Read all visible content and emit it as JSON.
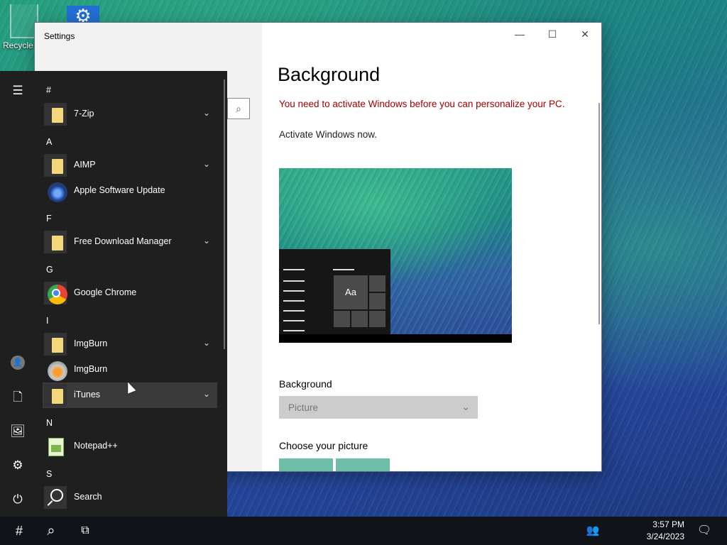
{
  "desktop": {
    "recycle_label": "Recycle",
    "recycle_icon": "recycle-bin-icon",
    "settings_icon": "gear-icon"
  },
  "settings_window": {
    "title": "Settings",
    "minimize_glyph": "—",
    "maximize_glyph": "☐",
    "close_glyph": "✕",
    "search_glyph": "⌕",
    "page_title": "Background",
    "warning": "You need to activate Windows before you can personalize your PC.",
    "activate_link": "Activate Windows now.",
    "preview_tile_text": "Aa",
    "background_label": "Background",
    "background_value": "Picture",
    "choose_picture_label": "Choose your picture",
    "warning_color": "#a80000"
  },
  "start_menu": {
    "rail": {
      "hamburger": "☰",
      "avatar_glyph": "👤",
      "documents": "🗋",
      "pictures": "🖼",
      "settings": "⚙",
      "power": "⏻"
    },
    "groups": [
      {
        "letter": "#"
      },
      {
        "letter": "A"
      },
      {
        "letter": "F"
      },
      {
        "letter": "G"
      },
      {
        "letter": "I"
      },
      {
        "letter": "N"
      },
      {
        "letter": "S"
      }
    ],
    "apps": [
      {
        "name": "7-Zip",
        "type": "folder",
        "expandable": true
      },
      {
        "name": "AIMP",
        "type": "folder",
        "expandable": true
      },
      {
        "name": "Apple Software Update",
        "type": "app",
        "expandable": false
      },
      {
        "name": "Free Download Manager",
        "type": "folder",
        "expandable": true
      },
      {
        "name": "Google Chrome",
        "type": "app",
        "expandable": false
      },
      {
        "name": "ImgBurn",
        "type": "folder",
        "expandable": true
      },
      {
        "name": "ImgBurn",
        "type": "app",
        "expandable": false
      },
      {
        "name": "iTunes",
        "type": "folder",
        "expandable": true
      },
      {
        "name": "Notepad++",
        "type": "app",
        "expandable": false
      },
      {
        "name": "Search",
        "type": "app",
        "expandable": false
      }
    ],
    "chevron": "⌄"
  },
  "taskbar": {
    "start_glyph": "#",
    "search_glyph": "⌕",
    "taskview_glyph": "⧉",
    "people_glyph": "👥",
    "time": "3:57 PM",
    "date": "3/24/2023",
    "notifications_glyph": "🗨"
  }
}
